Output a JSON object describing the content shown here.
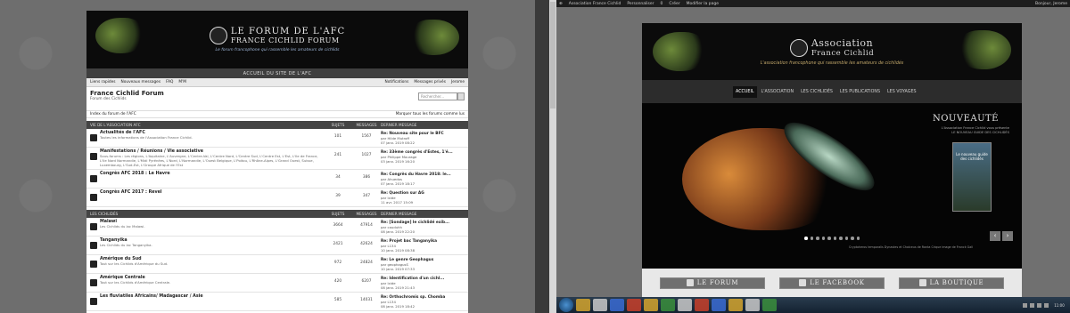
{
  "forum": {
    "banner": {
      "title_line1": "LE FORUM DE L'AFC",
      "title_line2": "FRANCE CICHLID FORUM",
      "slogan": "Le forum francophone qui rassemble les amateurs de cichlids"
    },
    "accueil_link": "ACCUEIL DU SITE DE L'AFC",
    "navbar": {
      "faq": "Liens rapides",
      "new_messages": "Nouveaux messages",
      "help": "FAQ",
      "register": "M'M",
      "notifications": "Notifications",
      "private_messages": "Messages privés",
      "user": "Jerome"
    },
    "header": {
      "title": "France Cichlid Forum",
      "subtitle": "Forum des Cichlids",
      "search_placeholder": "Rechercher..."
    },
    "crumbs": {
      "index": "Index du forum de l'AFC",
      "mark_read": "Marquer tous les forums comme lus"
    },
    "columns": {
      "subjects": "SUJETS",
      "messages": "MESSAGES",
      "last_message": "DERNIER MESSAGE"
    },
    "sections": [
      {
        "title": "VIE DE L'ASSOCIATION AFC",
        "rows": [
          {
            "name": "Actualités de l'AFC",
            "desc": "Toutes les informations de l'Association France Cichlid.",
            "subjects": "101",
            "messages": "1567",
            "last_title": "Re: Nouveau site pour le BFC",
            "last_by": "par Hilde Mutroff",
            "last_date": "07 janv. 2019 08:22"
          },
          {
            "name": "Manifestations / Réunions / Vie associative",
            "desc": "Sous-forums : Les régions, L'Aquitaine, L'Auvergne, L'Centre-Val, L'Centre Nord, L'Centre Sud, L'Centre Est, L'Est, L'Ile de France, L'Ile Nord Normandie, L'Midi Pyrénées, L'Nord, L'Normandie, L'Ouest Belgique, L'Poitou, L'Rhône-Alpes, L'Grand Ouest, Suisse, Luxembourg, L'Sud-Est, L'Groupe Afrique de l'Est",
            "subjects": "241",
            "messages": "1027",
            "last_title": "Re: 33ème congrès d'Estes, 1'é...",
            "last_by": "par Philippe Mourage",
            "last_date": "03 janv. 2019 16:20"
          },
          {
            "name": "Congrès AFC 2018 : Le Havre",
            "desc": "",
            "subjects": "34",
            "messages": "386",
            "last_title": "Re: Congrès du Havre 2018: le...",
            "last_by": "par Ahuedos",
            "last_date": "07 janv. 2019 18:17"
          },
          {
            "name": "Congrès AFC 2017 : Revel",
            "desc": "",
            "subjects": "39",
            "messages": "347",
            "last_title": "Re: Question sur AG",
            "last_by": "par lxide",
            "last_date": "11 avr. 2017 15:09"
          }
        ]
      },
      {
        "title": "LES CICHLIDÉS",
        "rows": [
          {
            "name": "Malawi",
            "desc": "Les Cichlids du lac Malawi.",
            "subjects": "3664",
            "messages": "47914",
            "last_title": "Re: [Sondage] le cichlidé exib...",
            "last_by": "par cauduhh",
            "last_date": "08 janv. 2019 22:20"
          },
          {
            "name": "Tanganyika",
            "desc": "Les Cichlids du lac Tanganyika.",
            "subjects": "2421",
            "messages": "42624",
            "last_title": "Re: Projet bac Tanganyika",
            "last_by": "par L134",
            "last_date": "10 janv. 2019 08:38"
          },
          {
            "name": "Amérique du Sud",
            "desc": "Tout sur les Cichlids d'Amérique du Sud.",
            "subjects": "972",
            "messages": "24824",
            "last_title": "Re: Le genre Geophagus",
            "last_by": "par geophagusS",
            "last_date": "10 janv. 2019 07:33"
          },
          {
            "name": "Amérique Centrale",
            "desc": "Tout sur les Cichlids d'Amérique Centrale.",
            "subjects": "420",
            "messages": "6207",
            "last_title": "Re: Identification d'un cichl...",
            "last_by": "par lxide",
            "last_date": "08 janv. 2019 21:43"
          },
          {
            "name": "Les fluviatiles Africains/ Madagascar / Asie",
            "desc": "",
            "subjects": "585",
            "messages": "14031",
            "last_title": "Re: Orthochromis sp. Chomba",
            "last_by": "par L134",
            "last_date": "08 janv. 2019 18:42"
          }
        ]
      }
    ]
  },
  "wpbar": {
    "site": "Association France Cichlid",
    "customize": "Personnaliser",
    "comments": "0",
    "new": "Créer",
    "edit": "Modifier la page",
    "greeting": "Bonjour, Jerome"
  },
  "site": {
    "banner": {
      "title_line1": "Association",
      "title_line2": "France Cichlid",
      "slogan": "L'association francophone qui rassemble les amateurs de cichlidés"
    },
    "menu": [
      "ACCUEIL",
      "L'ASSOCIATION",
      "LES CICHLIDÉS",
      "LES PUBLICATIONS",
      "LES VOYAGES"
    ],
    "slider": {
      "heading": "NOUVEAUTÉ",
      "sub": "L'Association France Cichlid vous présente LE NOUVEAU GUIDE DES CICHLIDÉS",
      "book_title": "Le nouveau guide des cichlidés",
      "caption": "Cryptoheros temporalis Dynastes et Chalceus de Ranta Crique image de Franck Gall",
      "dots": 10,
      "active_dot": 0
    },
    "buttons": [
      "LE FORUM",
      "LE FACEBOOK",
      "LA BOUTIQUE"
    ]
  },
  "taskbar": {
    "time": "11:00"
  }
}
